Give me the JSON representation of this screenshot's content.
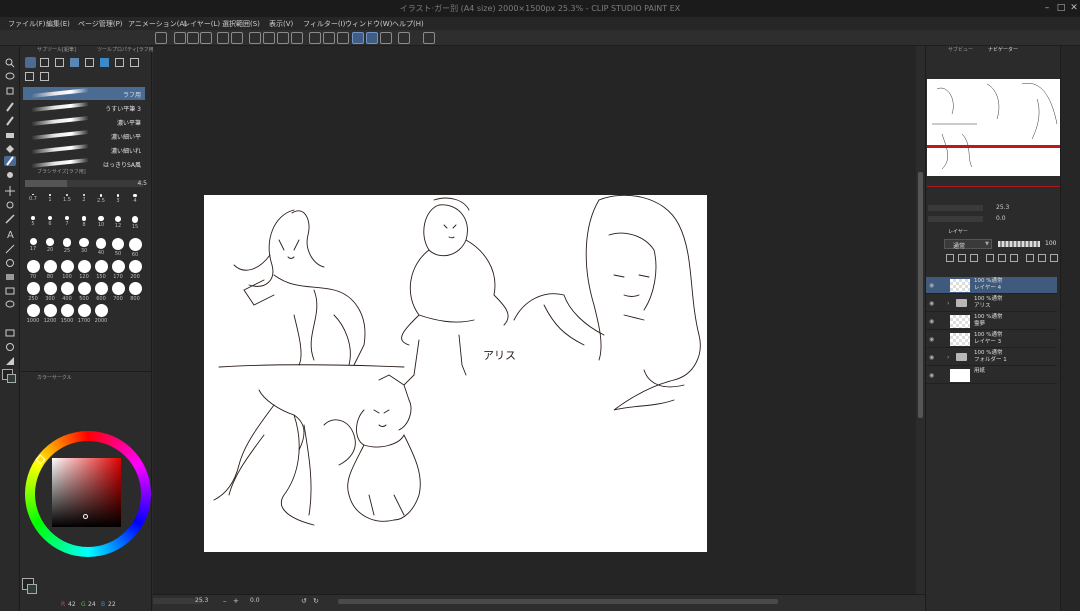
{
  "window": {
    "title": "イラスト·ガー別 (A4 size) 2000×1500px 25.3% - CLIP STUDIO PAINT EX"
  },
  "menu": [
    "ファイル(F)",
    "編集(E)",
    "ページ管理(P)",
    "アニメーション(A)",
    "レイヤー(L)",
    "選択範囲(S)",
    "表示(V)",
    "フィルター(I)",
    "ウィンドウ(W)",
    "ヘルプ(H)"
  ],
  "subtool_panel": {
    "tab1": "サブツール[鉛筆]",
    "tab2": "ツールプロパティ[ラフ用]",
    "brushes": [
      {
        "label": "ラフ用",
        "selected": true
      },
      {
        "label": "うすい平筆 3",
        "selected": false
      },
      {
        "label": "濃い平筆",
        "selected": false
      },
      {
        "label": "濃い細い平",
        "selected": false
      },
      {
        "label": "濃い細いれ",
        "selected": false
      },
      {
        "label": "はっきりSA風",
        "selected": false
      }
    ],
    "brush_size_header": "ブラシサイズ[ラフ用]",
    "brush_size_value": "4.5",
    "sizes": [
      "0.7",
      "1",
      "1.5",
      "2",
      "2.5",
      "3",
      "4",
      "5",
      "6",
      "7",
      "8",
      "10",
      "12",
      "15",
      "17",
      "20",
      "25",
      "30",
      "40",
      "50",
      "60",
      "70",
      "80",
      "100",
      "120",
      "150",
      "170",
      "200",
      "250",
      "300",
      "400",
      "500",
      "600",
      "700",
      "800",
      "1000",
      "1200",
      "1500",
      "1700",
      "2000"
    ]
  },
  "color_panel": {
    "tab": "カラーサークル",
    "accent": "#e00000",
    "r": "42",
    "g": "24",
    "b": "22"
  },
  "canvas": {
    "annotation": "アリス"
  },
  "status": {
    "zoom": "25.3",
    "angle": "0.0"
  },
  "navigator": {
    "tab1": "サブビュー",
    "tab2": "ナビゲーター",
    "zoom": "25.3",
    "angle": "0.0"
  },
  "layer_panel": {
    "tab": "レイヤー",
    "blend_mode": "通常",
    "opacity": "100",
    "layers": [
      {
        "line1": "100 %通常",
        "line2": "レイヤー 4",
        "type": "raster",
        "selected": true
      },
      {
        "line1": "100 %通常",
        "line2": "アリス",
        "type": "folder",
        "selected": false
      },
      {
        "line1": "100 %通常",
        "line2": "霊夢",
        "type": "raster",
        "selected": false
      },
      {
        "line1": "100 %通常",
        "line2": "レイヤー 3",
        "type": "raster",
        "selected": false
      },
      {
        "line1": "100 %通常",
        "line2": "フォルダー 1",
        "type": "folder",
        "selected": false
      },
      {
        "line1": "",
        "line2": "用紙",
        "type": "paper",
        "selected": false
      }
    ]
  }
}
